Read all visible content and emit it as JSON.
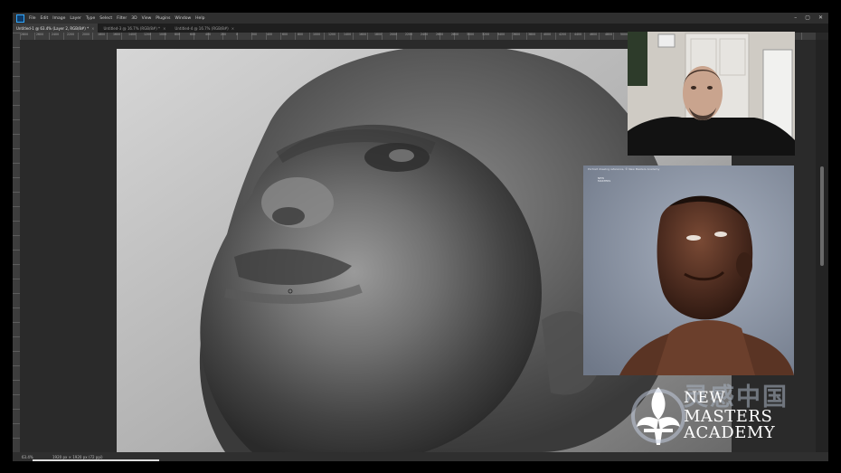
{
  "window": {
    "menu": [
      "File",
      "Edit",
      "Image",
      "Layer",
      "Type",
      "Select",
      "Filter",
      "3D",
      "View",
      "Plugins",
      "Window",
      "Help"
    ],
    "controls": {
      "minimize": "–",
      "maximize": "▢",
      "close": "✕"
    }
  },
  "tabs": [
    {
      "label": "Untitled-1 @ 63.4% (Layer 2, RGB/8#) *",
      "close": "×",
      "active": true
    },
    {
      "label": "Untitled-3 @ 16.7% (RGB/8#) *",
      "close": "×",
      "active": false
    },
    {
      "label": "Untitled-4 @ 16.7% (RGB/8#)",
      "close": "×",
      "active": false
    }
  ],
  "ruler": {
    "marks": [
      "2800",
      "2600",
      "2400",
      "2200",
      "2000",
      "1800",
      "1600",
      "1400",
      "1200",
      "1000",
      "800",
      "600",
      "400",
      "200",
      "0",
      "200",
      "400",
      "600",
      "800",
      "1000",
      "1200",
      "1400",
      "1600",
      "1800",
      "2000",
      "2200",
      "2400",
      "2600",
      "2800",
      "3000",
      "3200",
      "3400",
      "3600",
      "3800",
      "4000",
      "4200",
      "4400",
      "4600",
      "4800",
      "5000",
      "5200",
      "5400",
      "5600",
      "5800",
      "6000"
    ]
  },
  "status": {
    "zoom": "63.4%",
    "doc": "1920 px × 1920 px (72 ppi)"
  },
  "reference": {
    "caption": "Portrait drawing reference, © New Masters Academy",
    "logo_line1": "NEW",
    "logo_line2": "MASTERS"
  },
  "watermark": {
    "line1": "NEW",
    "line2": "MASTERS",
    "line3": "ACADEMY",
    "cn": "灵感中国"
  },
  "colors": {
    "app_bg": "#282828",
    "menubar": "#2f2f2f",
    "canvas_light": "#dcdcdc",
    "reference_bg": "#8a95a6",
    "ps_accent": "#31a8ff"
  }
}
